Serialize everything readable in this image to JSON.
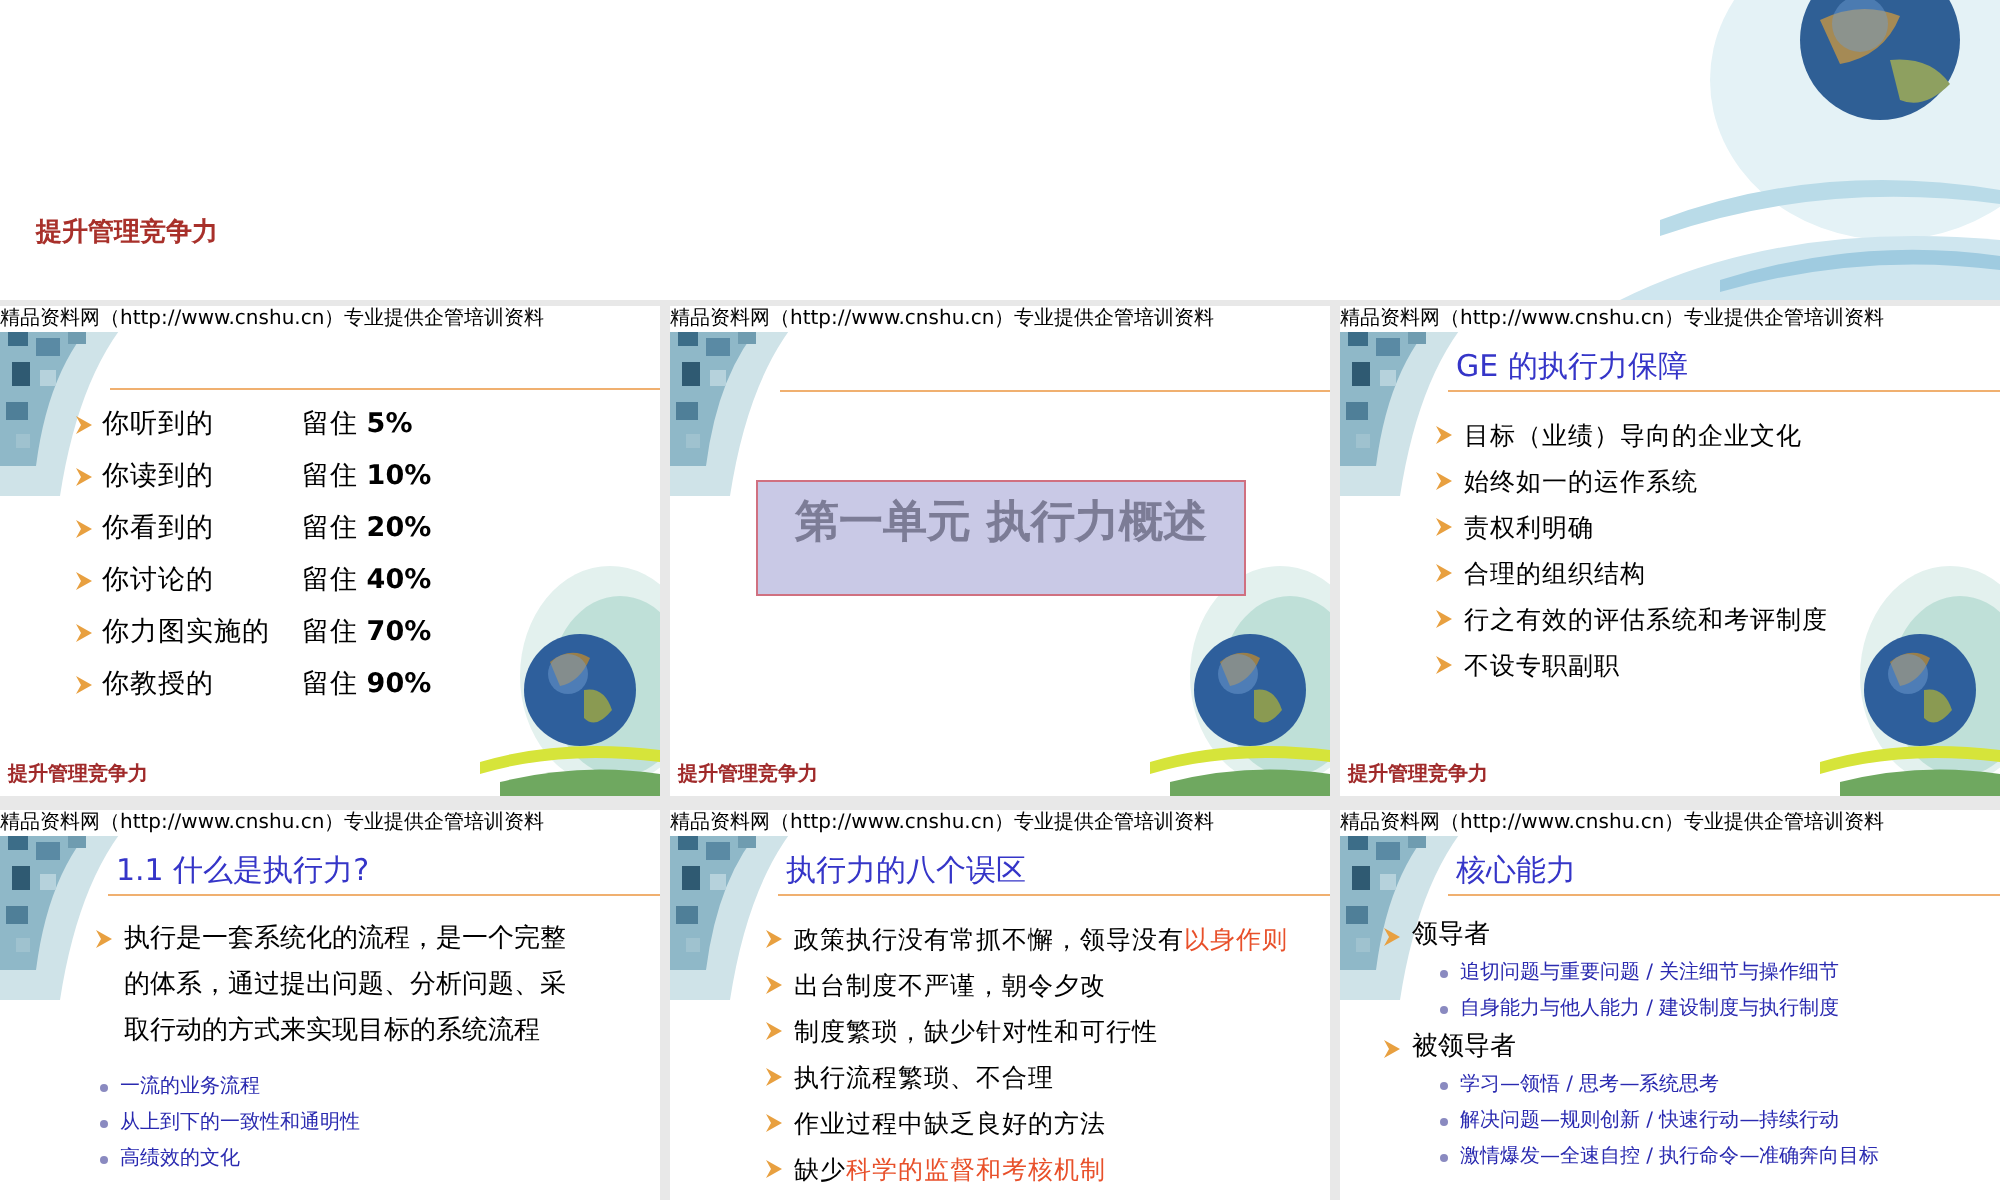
{
  "page_title": "提升管理竞争力",
  "slides": [
    {
      "kind": "retention",
      "header": "精品资料网（http://www.cnshu.cn）专业提供企管培训资料",
      "footer": "提升管理竞争力",
      "items": [
        {
          "label": "你听到的",
          "value": "留住 **5%**"
        },
        {
          "label": "你读到的",
          "value": "留住 **10%**"
        },
        {
          "label": "你看到的",
          "value": "留住 **20%**"
        },
        {
          "label": "你讨论的",
          "value": "留住 **40%**"
        },
        {
          "label": "你力图实施的",
          "value": "留住 **70%**"
        },
        {
          "label": "你教授的",
          "value": "留住 **90%**"
        }
      ]
    },
    {
      "kind": "section",
      "header": "精品资料网（http://www.cnshu.cn）专业提供企管培训资料",
      "footer": "提升管理竞争力",
      "heading": "第一单元 执行力概述"
    },
    {
      "kind": "bullets",
      "header": "精品资料网（http://www.cnshu.cn）专业提供企管培训资料",
      "footer": "提升管理竞争力",
      "title": "GE 的执行力保障",
      "items": [
        {
          "kind": "main",
          "segments": [
            {
              "text": "目标（业绩）导向的企业文化",
              "highlight": false
            }
          ]
        },
        {
          "kind": "main",
          "segments": [
            {
              "text": "始终如一的运作系统",
              "highlight": false
            }
          ]
        },
        {
          "kind": "main",
          "segments": [
            {
              "text": "责权利明确",
              "highlight": false
            }
          ]
        },
        {
          "kind": "main",
          "segments": [
            {
              "text": "合理的组织结构",
              "highlight": false
            }
          ]
        },
        {
          "kind": "main",
          "segments": [
            {
              "text": "行之有效的评估系统和考评制度",
              "highlight": false
            }
          ]
        },
        {
          "kind": "main",
          "segments": [
            {
              "text": "不设专职副职",
              "highlight": false
            }
          ]
        }
      ]
    },
    {
      "kind": "bullets",
      "header": "精品资料网（http://www.cnshu.cn）专业提供企管培训资料",
      "title": "1.1  什么是执行力?",
      "items": [
        {
          "kind": "paragraph",
          "segments": [
            {
              "text": "执行是一套系统化的流程，是一个完整的体系，通过提出问题、分析问题、采取行动的方式来实现目标的系统流程",
              "highlight": false
            }
          ]
        },
        {
          "kind": "sub",
          "segments": [
            {
              "text": "一流的业务流程",
              "highlight": false
            }
          ]
        },
        {
          "kind": "sub",
          "segments": [
            {
              "text": "从上到下的一致性和通明性",
              "highlight": false
            }
          ]
        },
        {
          "kind": "sub",
          "segments": [
            {
              "text": "高绩效的文化",
              "highlight": false
            }
          ]
        }
      ]
    },
    {
      "kind": "bullets",
      "header": "精品资料网（http://www.cnshu.cn）专业提供企管培训资料",
      "title": "执行力的八个误区",
      "items": [
        {
          "kind": "main",
          "segments": [
            {
              "text": "政策执行没有常抓不懈，领导没有",
              "highlight": false
            },
            {
              "text": "以身作则",
              "highlight": true
            }
          ]
        },
        {
          "kind": "main",
          "segments": [
            {
              "text": "出台制度不严谨，朝令夕改",
              "highlight": false
            }
          ]
        },
        {
          "kind": "main",
          "segments": [
            {
              "text": "制度繁琐，缺少针对性和可行性",
              "highlight": false
            }
          ]
        },
        {
          "kind": "main",
          "segments": [
            {
              "text": "执行流程繁琐、不合理",
              "highlight": false
            }
          ]
        },
        {
          "kind": "main",
          "segments": [
            {
              "text": "作业过程中缺乏良好的方法",
              "highlight": false
            }
          ]
        },
        {
          "kind": "main",
          "segments": [
            {
              "text": "缺少",
              "highlight": false
            },
            {
              "text": "科学的监督和考核机制",
              "highlight": true
            }
          ]
        }
      ]
    },
    {
      "kind": "bullets",
      "header": "精品资料网（http://www.cnshu.cn）专业提供企管培训资料",
      "title": "核心能力",
      "items": [
        {
          "kind": "head",
          "segments": [
            {
              "text": "领导者",
              "highlight": false
            }
          ]
        },
        {
          "kind": "sub",
          "segments": [
            {
              "text": "追切问题与重要问题  /  关注细节与操作细节",
              "highlight": false
            }
          ]
        },
        {
          "kind": "sub",
          "segments": [
            {
              "text": "自身能力与他人能力  /  建设制度与执行制度",
              "highlight": false
            }
          ]
        },
        {
          "kind": "head",
          "segments": [
            {
              "text": "被领导者",
              "highlight": false
            }
          ]
        },
        {
          "kind": "sub",
          "segments": [
            {
              "text": "学习—领悟  /  思考—系统思考",
              "highlight": false
            }
          ]
        },
        {
          "kind": "sub",
          "segments": [
            {
              "text": "解决问题—规则创新  /  快速行动—持续行动",
              "highlight": false
            }
          ]
        },
        {
          "kind": "sub",
          "segments": [
            {
              "text": "激情爆发—全速自控  /  执行命令—准确奔向目标",
              "highlight": false
            }
          ]
        }
      ]
    }
  ]
}
